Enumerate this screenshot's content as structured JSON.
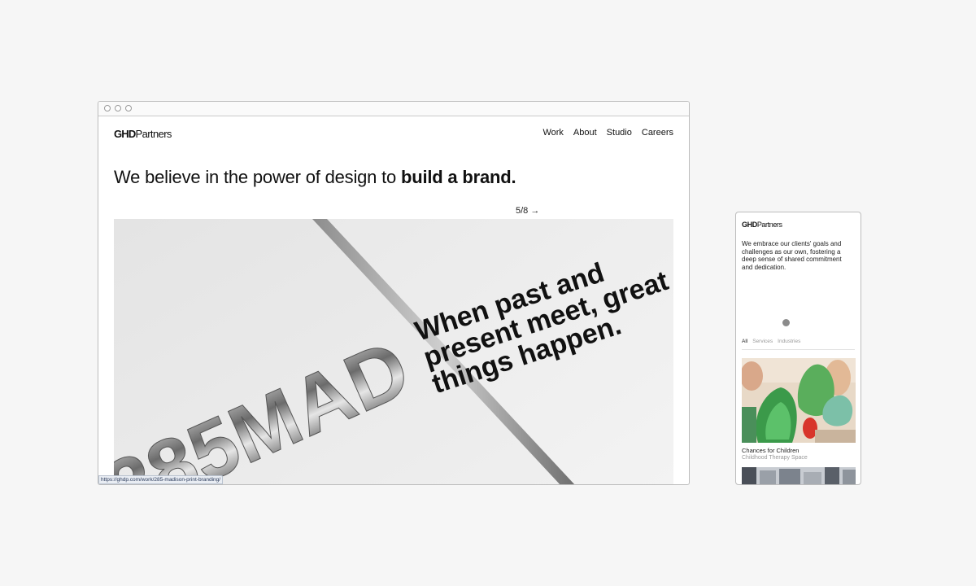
{
  "desktop": {
    "logo": {
      "bold": "GHD",
      "regular": "Partners"
    },
    "nav": [
      "Work",
      "About",
      "Studio",
      "Careers"
    ],
    "hero": {
      "lead": "We believe in the power of design to ",
      "emphasis": "build a brand."
    },
    "image": {
      "poster_text": [
        "When past and",
        "present meet, great",
        "things happen."
      ],
      "large_type": "285MAD"
    },
    "slide_counter": "5/8 →",
    "status_url": "https://ghdp.com/work/285-madison-print-branding/"
  },
  "mobile": {
    "logo": {
      "bold": "GHD",
      "regular": "Partners"
    },
    "intro": "We embrace our clients' goals and challenges as our own, fostering a deep sense of shared commitment and dedication.",
    "tabs": [
      "All",
      "Services",
      "Industries"
    ],
    "card": {
      "title": "Chances for Children",
      "subtitle": "Childhood Therapy Space"
    }
  }
}
